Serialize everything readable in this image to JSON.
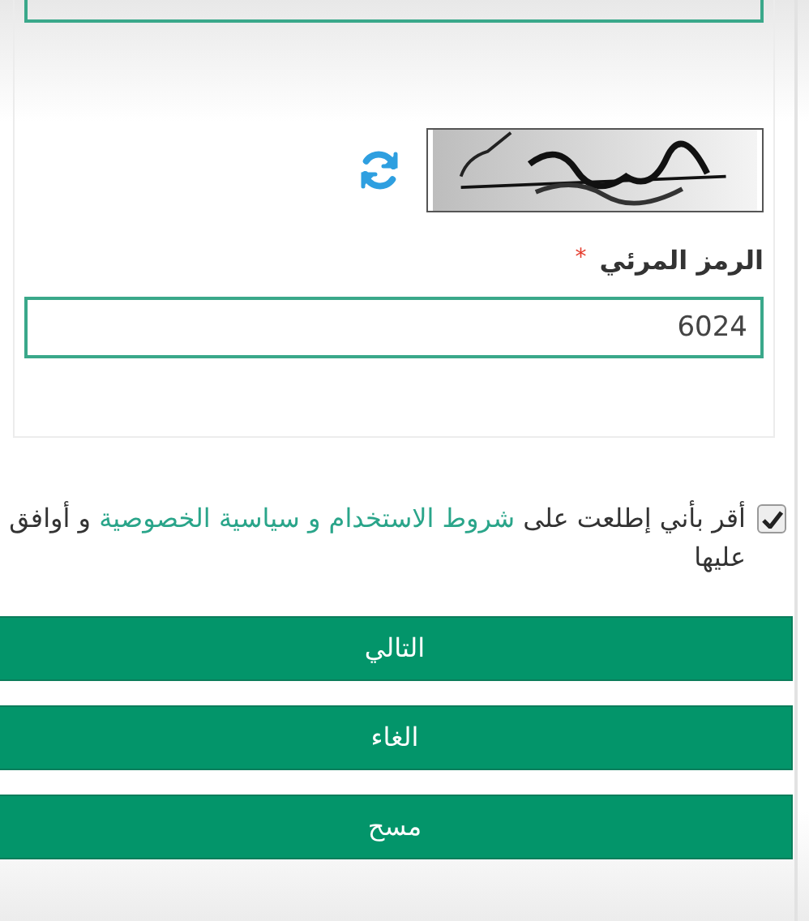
{
  "captcha_field": {
    "label": "الرمز المرئي",
    "required_mark": "*",
    "value": "6024"
  },
  "agreement": {
    "checked": true,
    "text_before": "أقر بأني إطلعت على",
    "link": "شروط الاستخدام و سياسية الخصوصية",
    "text_after": "و أوافق عليها"
  },
  "buttons": [
    {
      "label": "التالي"
    },
    {
      "label": "الغاء"
    },
    {
      "label": "مسح"
    }
  ]
}
